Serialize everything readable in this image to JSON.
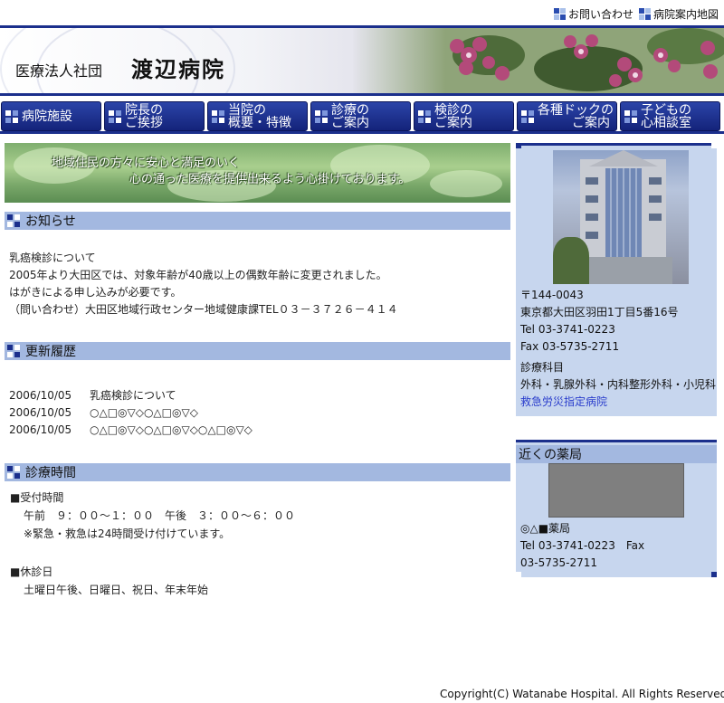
{
  "toplinks": [
    {
      "label": "お問い合わせ"
    },
    {
      "label": "病院案内地図"
    }
  ],
  "header": {
    "org_type": "医療法人社団",
    "hospital_name": "渡辺病院"
  },
  "nav": [
    {
      "line1": "病院施設",
      "line2": ""
    },
    {
      "line1": "院長の",
      "line2": "ご挨拶"
    },
    {
      "line1": "当院の",
      "line2": "概要・特徴"
    },
    {
      "line1": "診療の",
      "line2": "ご案内"
    },
    {
      "line1": "検診の",
      "line2": "ご案内"
    },
    {
      "line1": "各種ドックの",
      "line2": "ご案内"
    },
    {
      "line1": "子どもの",
      "line2": "心相談室"
    }
  ],
  "hero": {
    "line1": "地域住民の方々に安心と満足のいく",
    "line2": "心の通った医療を提供出来るよう心掛けております。"
  },
  "news": {
    "title": "お知らせ",
    "lines": [
      "乳癌検診について",
      "2005年より大田区では、対象年齢が40歳以上の偶数年齢に変更されました。",
      "はがきによる申し込みが必要です。",
      "（問い合わせ）大田区地域行政センター地域健康課TEL０３－３７２６－４１４"
    ]
  },
  "history": {
    "title": "更新履歴",
    "rows": [
      {
        "date": "2006/10/05",
        "text": "乳癌検診について"
      },
      {
        "date": "2006/10/05",
        "text": "○△□◎▽◇○△□◎▽◇"
      },
      {
        "date": "2006/10/05",
        "text": "○△□◎▽◇○△□◎▽◇○△□◎▽◇"
      }
    ]
  },
  "hours": {
    "title": "診療時間",
    "reception_label": "■受付時間",
    "reception_time": "午前　９：００～１：００　午後　３：００～６：００",
    "emergency_note": "※緊急・救急は24時間受け付けています。",
    "closed_label": "■休診日",
    "closed_days": "土曜日午後、日曜日、祝日、年末年始"
  },
  "side": {
    "postal": "〒144-0043",
    "address": "東京都大田区羽田1丁目5番16号",
    "tel": "Tel 03-3741-0223",
    "fax": "Fax 03-5735-2711",
    "dept_title": "診療科目",
    "depts": "外科・乳腺外科・内科整形外科・小児科",
    "designation_link": "救急労災指定病院"
  },
  "pharmacy": {
    "title": "近くの薬局",
    "name": "◎△■薬局",
    "tel_fax": "Tel 03-3741-0223　Fax",
    "fax_num": "03-5735-2711"
  },
  "footer": {
    "copyright": "Copyright(C) Watanabe Hospital. All Rights Reserved."
  },
  "colors": {
    "nav_blue": "#1b2f8c",
    "section_head": "#a3b8e0",
    "side_bg": "#c7d6ee",
    "link": "#2a3dcc"
  }
}
